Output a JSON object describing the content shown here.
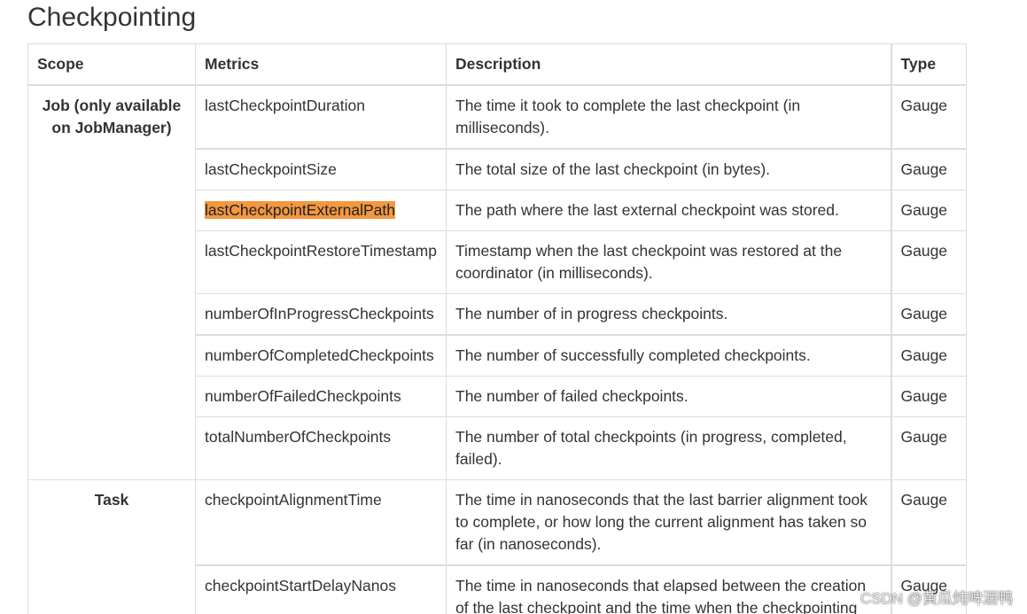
{
  "heading": "Checkpointing",
  "table": {
    "columns": [
      "Scope",
      "Metrics",
      "Description",
      "Type"
    ],
    "groups": [
      {
        "scope": "Job (only available on JobManager)",
        "rows": [
          {
            "metric": "lastCheckpointDuration",
            "description": "The time it took to complete the last checkpoint (in milliseconds).",
            "type": "Gauge",
            "highlighted": false
          },
          {
            "metric": "lastCheckpointSize",
            "description": "The total size of the last checkpoint (in bytes).",
            "type": "Gauge",
            "highlighted": false
          },
          {
            "metric": "lastCheckpointExternalPath",
            "description": "The path where the last external checkpoint was stored.",
            "type": "Gauge",
            "highlighted": true
          },
          {
            "metric": "lastCheckpointRestoreTimestamp",
            "description": "Timestamp when the last checkpoint was restored at the coordinator (in milliseconds).",
            "type": "Gauge",
            "highlighted": false
          },
          {
            "metric": "numberOfInProgressCheckpoints",
            "description": "The number of in progress checkpoints.",
            "type": "Gauge",
            "highlighted": false
          },
          {
            "metric": "numberOfCompletedCheckpoints",
            "description": "The number of successfully completed checkpoints.",
            "type": "Gauge",
            "highlighted": false
          },
          {
            "metric": "numberOfFailedCheckpoints",
            "description": "The number of failed checkpoints.",
            "type": "Gauge",
            "highlighted": false
          },
          {
            "metric": "totalNumberOfCheckpoints",
            "description": "The number of total checkpoints (in progress, completed, failed).",
            "type": "Gauge",
            "highlighted": false
          }
        ]
      },
      {
        "scope": "Task",
        "rows": [
          {
            "metric": "checkpointAlignmentTime",
            "description": "The time in nanoseconds that the last barrier alignment took to complete, or how long the current alignment has taken so far (in nanoseconds).",
            "type": "Gauge",
            "highlighted": false
          },
          {
            "metric": "checkpointStartDelayNanos",
            "description": "The time in nanoseconds that elapsed between the creation of the last checkpoint and the time when the checkpointing",
            "type": "Gauge",
            "highlighted": false
          }
        ]
      }
    ]
  },
  "watermark": "CSDN @黄瓜炖啤酒鸭",
  "colors": {
    "highlight": "#f4973f",
    "border": "#dddddd",
    "text": "#333333"
  }
}
